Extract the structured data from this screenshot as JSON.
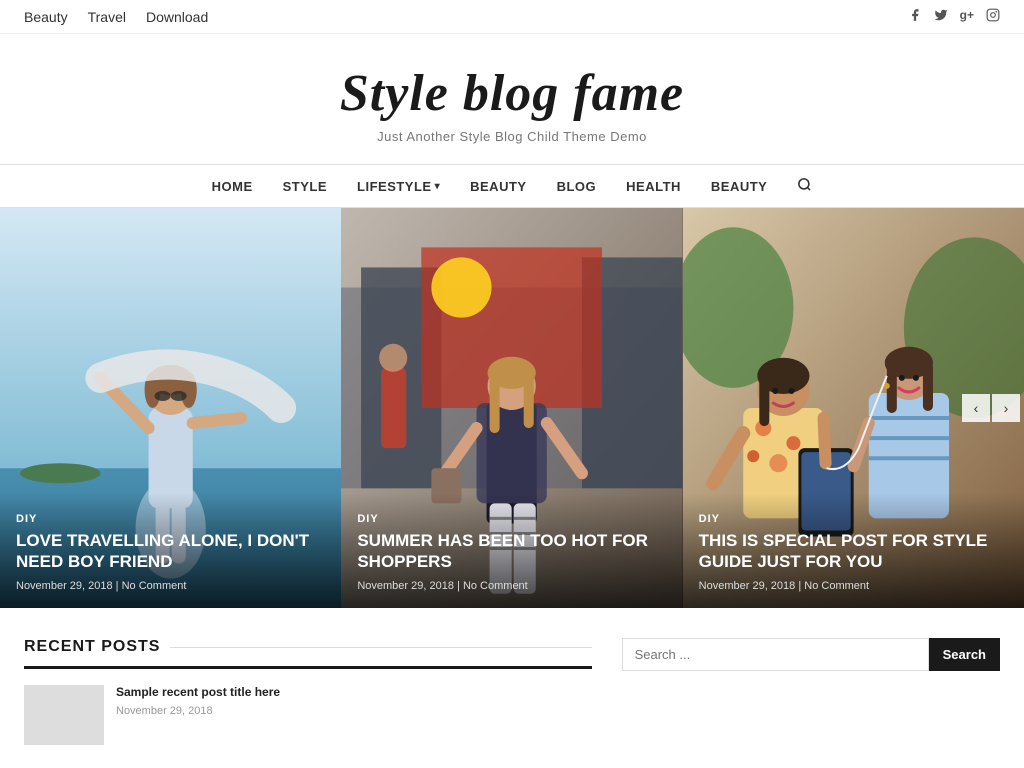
{
  "topNav": {
    "items": [
      {
        "label": "Beauty",
        "href": "#"
      },
      {
        "label": "Travel",
        "href": "#"
      },
      {
        "label": "Download",
        "href": "#"
      }
    ]
  },
  "socialIcons": [
    {
      "name": "facebook-icon",
      "symbol": "f"
    },
    {
      "name": "twitter-icon",
      "symbol": "t"
    },
    {
      "name": "google-plus-icon",
      "symbol": "g+"
    },
    {
      "name": "instagram-icon",
      "symbol": "◉"
    }
  ],
  "siteTitle": "Style blog fame",
  "siteSubtitle": "Just Another Style Blog Child Theme Demo",
  "mainNav": {
    "items": [
      {
        "label": "HOME",
        "hasDropdown": false
      },
      {
        "label": "STYLE",
        "hasDropdown": false
      },
      {
        "label": "LIFESTYLE",
        "hasDropdown": true
      },
      {
        "label": "BEAUTY",
        "hasDropdown": false
      },
      {
        "label": "BLOG",
        "hasDropdown": false
      },
      {
        "label": "HEALTH",
        "hasDropdown": false
      },
      {
        "label": "BEAUTY",
        "hasDropdown": false
      }
    ]
  },
  "slides": [
    {
      "category": "DIY",
      "title": "LOVE TRAVELLING ALONE, I DON'T NEED BOY FRIEND",
      "date": "November 29, 2018",
      "comments": "No Comment",
      "bgColor1": "#a8c5d8",
      "bgColor2": "#6a9db5"
    },
    {
      "category": "DIY",
      "title": "SUMMER HAS BEEN TOO HOT FOR SHOPPERS",
      "date": "November 29, 2018",
      "comments": "No Comment",
      "bgColor1": "#9a8878",
      "bgColor2": "#6a5848"
    },
    {
      "category": "DIY",
      "title": "THIS IS SPECIAL POST FOR STYLE GUIDE JUST FOR YOU",
      "date": "November 29, 2018",
      "comments": "No Comment",
      "bgColor1": "#c8b090",
      "bgColor2": "#907050"
    }
  ],
  "recentPostsTitle": "RECENT POSTS",
  "searchPlaceholder": "Search ...",
  "searchButtonLabel": "Search",
  "sliderPrevLabel": "‹",
  "sliderNextLabel": "›"
}
